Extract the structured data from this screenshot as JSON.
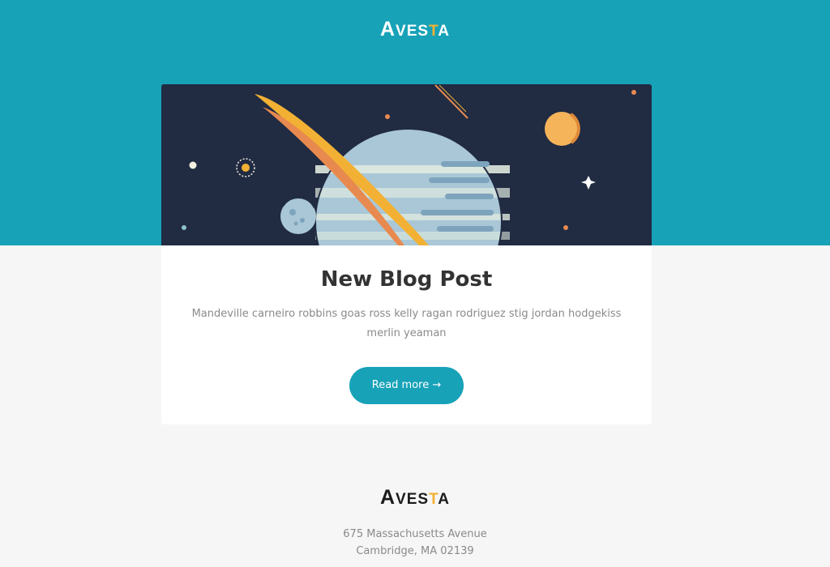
{
  "header": {
    "logo": {
      "first": "A",
      "middle": "VES",
      "accent": "T",
      "last": "A"
    }
  },
  "post": {
    "title": "New Blog Post",
    "excerpt": "Mandeville carneiro robbins goas ross kelly ragan rodriguez stig jordan hodgekiss merlin yeaman",
    "button_label": "Read more →",
    "image_icon": "space-planet-illustration"
  },
  "footer": {
    "logo": {
      "first": "A",
      "middle": "VES",
      "accent": "T",
      "last": "A"
    },
    "address_line1": "675 Massachusetts Avenue",
    "address_line2": "Cambridge, MA 02139"
  },
  "colors": {
    "brand": "#17a2b8",
    "accent": "#f2b134",
    "space_bg": "#212b42",
    "page_bg": "#f6f6f6",
    "text_dark": "#333333",
    "text_muted": "#8a8a8a"
  }
}
